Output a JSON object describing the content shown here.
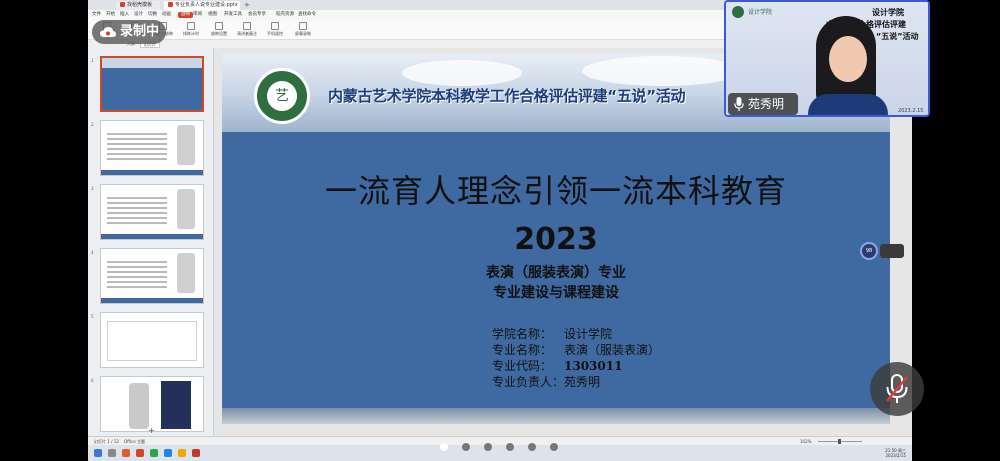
{
  "recording": {
    "label": "录制中"
  },
  "browser_tabs": [
    {
      "label": "找稻壳模板",
      "color": "#d24726"
    },
    {
      "label": "专业负责人说专业建设.pptx",
      "color": "#d24726"
    }
  ],
  "menu": [
    "文件",
    "开始",
    "插入",
    "设计",
    "切换",
    "动画",
    "放映",
    "审阅",
    "视图",
    "开发工具",
    "会员专享",
    "稻壳资源",
    "查找命令"
  ],
  "menu_active_index": 6,
  "ribbon": [
    "从头开始",
    "当页开始",
    "自定义放映",
    "排练计时",
    "放映设置",
    "演讲者备注",
    "手机遥控",
    "屏幕录制"
  ],
  "view_tabs": [
    "大纲",
    "幻灯片"
  ],
  "view_tab_active": 1,
  "slide": {
    "banner_title": "内蒙古艺术学院本科教学工作合格评估评建“五说”活动",
    "main_title": "一流育人理念引领一流本科教育",
    "year": "2023",
    "major_line": "表演（服装表演）专业",
    "subtitle": "专业建设与课程建设",
    "info": [
      {
        "label": "学院名称：",
        "value": "设计学院"
      },
      {
        "label": "专业名称：",
        "value": "表演（服装表演）"
      },
      {
        "label": "专业代码：",
        "value": "1303011"
      },
      {
        "label": "专业负责人：",
        "value": "苑秀明"
      }
    ]
  },
  "thumbnails": [
    {
      "num": "1",
      "selected": true
    },
    {
      "num": "2",
      "selected": false
    },
    {
      "num": "3",
      "selected": false
    },
    {
      "num": "4",
      "selected": false
    },
    {
      "num": "5",
      "selected": false
    },
    {
      "num": "6",
      "selected": false
    }
  ],
  "status": {
    "slide_counter": "幻灯片 1 / 12",
    "theme": "Office 主题",
    "zoom": "102%",
    "time": "21:50 周三",
    "date": "2023/2/15"
  },
  "video": {
    "logo_text": "设计学院",
    "line1": "设计学院",
    "line2": "本科教学合格评估评建",
    "line3": "“五说”活动",
    "date": "2023.2.15",
    "speaker_name": "苑秀明"
  },
  "side_widget": {
    "value": "98"
  },
  "pager": {
    "count": 6,
    "active": 0
  },
  "colors": {
    "accent": "#d24726",
    "slide_blue": "#3f6aa1",
    "title_blue": "#1d3e7a",
    "frame_blue": "#3a5bd8"
  }
}
